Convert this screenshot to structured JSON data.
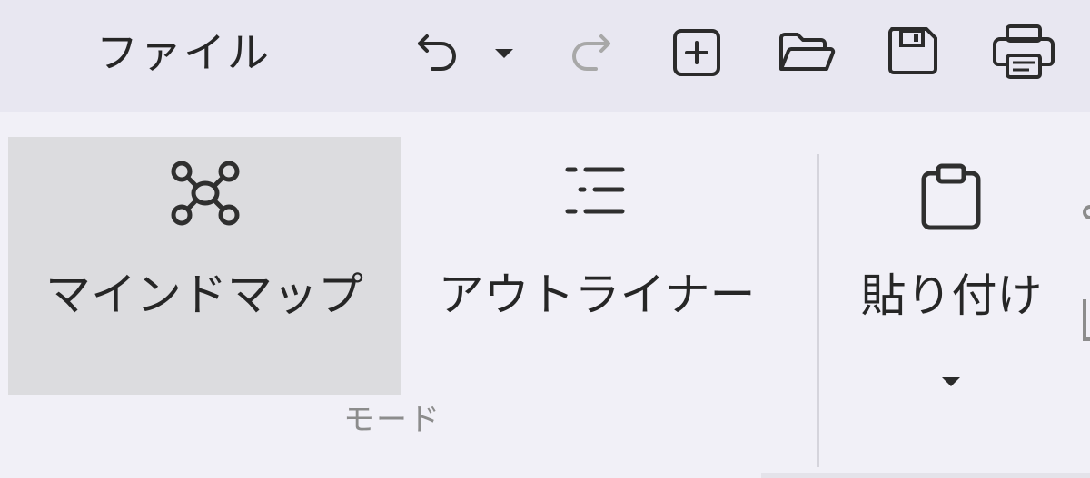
{
  "titlebar": {
    "file_menu_label": "ファイル",
    "quick_access": [
      "undo-icon",
      "undo-dropdown-icon",
      "redo-icon",
      "new-icon",
      "open-folder-icon",
      "save-icon",
      "print-icon"
    ]
  },
  "ribbon": {
    "mode_group": {
      "label": "モード",
      "buttons": [
        {
          "label": "マインドマップ",
          "icon": "mind-map-icon",
          "selected": true
        },
        {
          "label": "アウトライナー",
          "icon": "outliner-icon",
          "selected": false
        }
      ]
    },
    "clipboard_group": {
      "paste_label": "貼り付け",
      "paste_icon": "clipboard-icon"
    }
  },
  "colors": {
    "titlebar_bg": "#e8e7f1",
    "ribbon_bg": "#f1f0f7",
    "selected_bg": "#dcdcdf",
    "text": "#262626",
    "disabled": "#a8a8a8",
    "group_label": "#8c8c8c"
  }
}
